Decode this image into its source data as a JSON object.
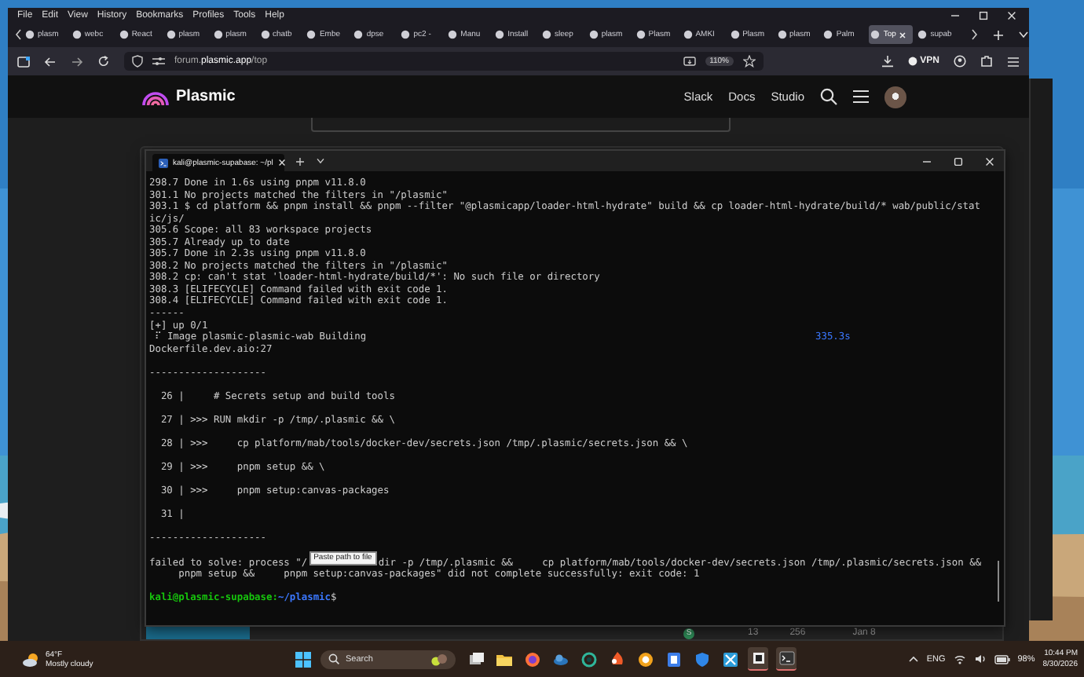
{
  "browser": {
    "menu": [
      "File",
      "Edit",
      "View",
      "History",
      "Bookmarks",
      "Profiles",
      "Tools",
      "Help"
    ],
    "tabs": [
      {
        "title": "plasm",
        "selected": false
      },
      {
        "title": "webc",
        "selected": false
      },
      {
        "title": "React",
        "selected": false
      },
      {
        "title": "plasm",
        "selected": false
      },
      {
        "title": "plasm",
        "selected": false
      },
      {
        "title": "chatb",
        "selected": false
      },
      {
        "title": "Embe",
        "selected": false
      },
      {
        "title": "dpse",
        "selected": false
      },
      {
        "title": "pc2 -",
        "selected": false
      },
      {
        "title": "Manu",
        "selected": false
      },
      {
        "title": "Install",
        "selected": false
      },
      {
        "title": "sleep",
        "selected": false
      },
      {
        "title": "plasm",
        "selected": false
      },
      {
        "title": "Plasm",
        "selected": false
      },
      {
        "title": "AMKI",
        "selected": false
      },
      {
        "title": "Plasm",
        "selected": false
      },
      {
        "title": "plasm",
        "selected": false
      },
      {
        "title": "Palm",
        "selected": false
      },
      {
        "title": "Top",
        "selected": true
      },
      {
        "title": "supab",
        "selected": false
      }
    ],
    "url": "forum.**plasmic.app**/top",
    "zoom": "110%",
    "vpn": "VPN"
  },
  "site": {
    "brand": "Plasmic",
    "nav": [
      "Slack",
      "Docs",
      "Studio"
    ]
  },
  "topic_row": {
    "avatar": "S",
    "replies": "13",
    "views": "256",
    "date": "Jan 8"
  },
  "terminal": {
    "tab_title": "kali@plasmic-supabase: ~/pl",
    "lines": [
      {
        "kind": "text",
        "text": "298.7 Done in 1.6s using pnpm v11.8.0"
      },
      {
        "kind": "text",
        "text": "301.1 No projects matched the filters in \"/plasmic\""
      },
      {
        "kind": "text",
        "text": "303.1 $ cd platform && pnpm install && pnpm --filter \"@plasmicapp/loader-html-hydrate\" build && cp loader-html-hydrate/build/* wab/public/stat"
      },
      {
        "kind": "text",
        "text": "ic/js/"
      },
      {
        "kind": "text",
        "text": "305.6 Scope: all 83 workspace projects"
      },
      {
        "kind": "text",
        "text": "305.7 Already up to date"
      },
      {
        "kind": "text",
        "text": "305.7 Done in 2.3s using pnpm v11.8.0"
      },
      {
        "kind": "text",
        "text": "308.2 No projects matched the filters in \"/plasmic\""
      },
      {
        "kind": "text",
        "text": "308.2 cp: can't stat 'loader-html-hydrate/build/*': No such file or directory"
      },
      {
        "kind": "text",
        "text": "308.3 [ELIFECYCLE] Command failed with exit code 1."
      },
      {
        "kind": "text",
        "text": "308.4 [ELIFECYCLE] Command failed with exit code 1."
      },
      {
        "kind": "text",
        "text": "------"
      },
      {
        "kind": "text",
        "text": "[+] up 0/1"
      },
      {
        "kind": "status",
        "text": " ⠏ Image plasmic-plasmic-wab Building",
        "time": "335.3s"
      },
      {
        "kind": "text",
        "text": "Dockerfile.dev.aio:27"
      },
      {
        "kind": "blank"
      },
      {
        "kind": "text",
        "text": "--------------------"
      },
      {
        "kind": "blank"
      },
      {
        "kind": "text",
        "text": "  26 |     # Secrets setup and build tools"
      },
      {
        "kind": "blank"
      },
      {
        "kind": "text",
        "text": "  27 | >>> RUN mkdir -p /tmp/.plasmic && \\"
      },
      {
        "kind": "blank"
      },
      {
        "kind": "text",
        "text": "  28 | >>>     cp platform/mab/tools/docker-dev/secrets.json /tmp/.plasmic/secrets.json && \\"
      },
      {
        "kind": "blank"
      },
      {
        "kind": "text",
        "text": "  29 | >>>     pnpm setup && \\"
      },
      {
        "kind": "blank"
      },
      {
        "kind": "text",
        "text": "  30 | >>>     pnpm setup:canvas-packages"
      },
      {
        "kind": "blank"
      },
      {
        "kind": "text",
        "text": "  31 |"
      },
      {
        "kind": "blank"
      },
      {
        "kind": "text",
        "text": "--------------------"
      },
      {
        "kind": "blank"
      },
      {
        "kind": "split",
        "before": "failed to solve: process \"/",
        "after": "dir -p /tmp/.plasmic &&     cp platform/mab/tools/docker-dev/secrets.json /tmp/.plasmic/secrets.json &&"
      },
      {
        "kind": "text",
        "text": "     pnpm setup &&     pnpm setup:canvas-packages\" did not complete successfully: exit code: 1"
      },
      {
        "kind": "blank"
      },
      {
        "kind": "prompt"
      }
    ],
    "tooltip": "Paste path to file",
    "prompt": {
      "user": "kali@plasmic-supabase:",
      "path": "~/plasmic",
      "symbol": "$"
    }
  },
  "taskbar": {
    "temperature": "64°F",
    "weather": "Mostly cloudy",
    "search": "Search",
    "language": "ENG",
    "battery": "98%",
    "time": "10:44 PM",
    "date": "8/30/2026"
  }
}
